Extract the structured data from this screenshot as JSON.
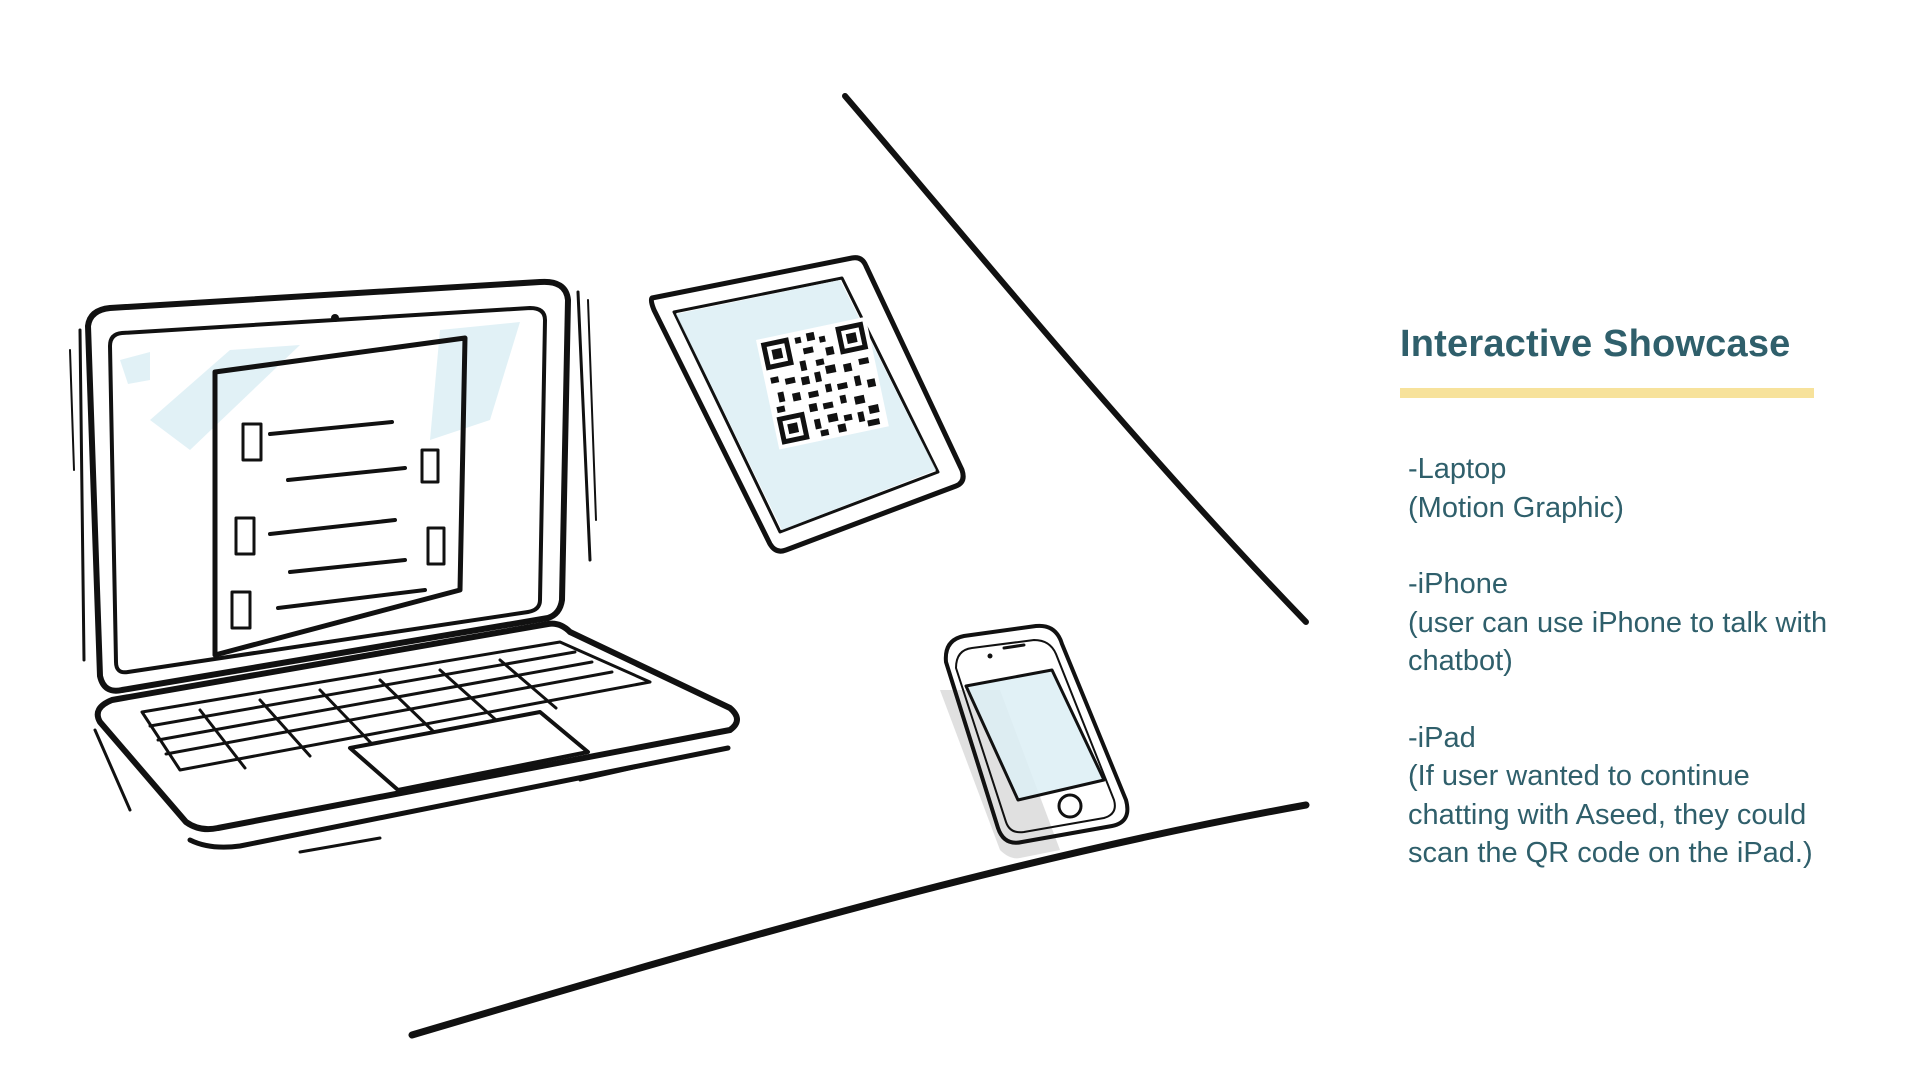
{
  "colors": {
    "title": "#2f5f6b",
    "body_text": "#2f5f6b",
    "underline": "#f7e29b",
    "screen_tint": "#dceef4",
    "ink": "#111111"
  },
  "title": "Interactive Showcase",
  "items": [
    {
      "name": "-Laptop",
      "description": "(Motion Graphic)"
    },
    {
      "name": "-iPhone",
      "description": "(user can use iPhone to talk with chatbot)"
    },
    {
      "name": "-iPad",
      "description": "(If user wanted to continue chatting with Aseed, they could scan the QR code on the iPad.)"
    }
  ],
  "illustration": {
    "devices": [
      "laptop",
      "ipad",
      "iphone"
    ],
    "ipad_screen_content": "qr-code-icon"
  }
}
